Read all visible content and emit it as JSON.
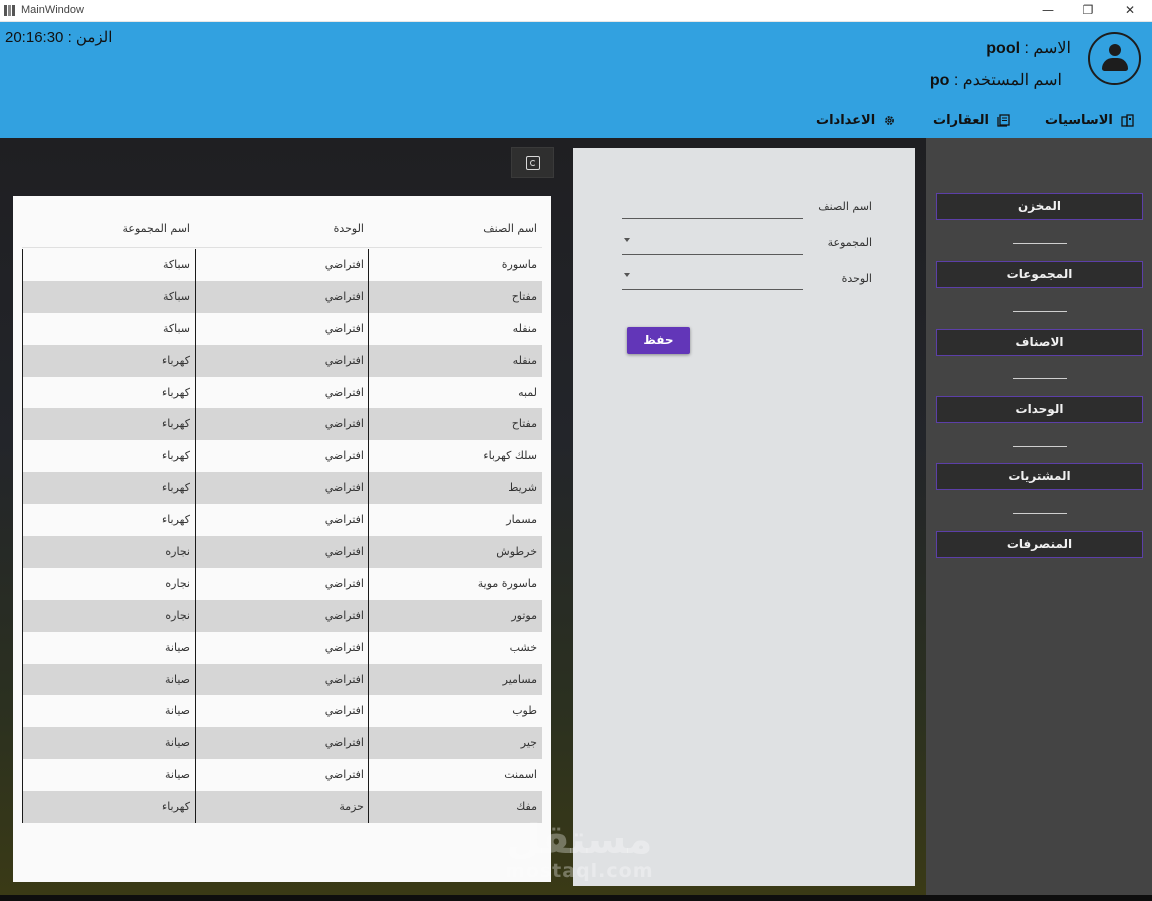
{
  "window": {
    "title": "MainWindow",
    "minimize": "—",
    "maximize": "❐",
    "close": "✕"
  },
  "header": {
    "name_label": "الاسم :",
    "name_value": "pool",
    "username_label": "اسم المستخدم :",
    "username_value": "po",
    "time_label": "الزمن :",
    "time_value": "20:16:30",
    "menu": [
      {
        "label": "الاساسيات",
        "icon": "building-icon"
      },
      {
        "label": "العقارات",
        "icon": "documents-icon"
      },
      {
        "label": "الاعدادات",
        "icon": "gear-icon"
      }
    ]
  },
  "sidebar": {
    "items": [
      "المخزن",
      "المجموعات",
      "الاصناف",
      "الوحدات",
      "المشتريات",
      "المنصرفات"
    ]
  },
  "form": {
    "item_name_label": "اسم الصنف",
    "item_name_value": "",
    "group_label": "المجموعة",
    "group_value": "",
    "unit_label": "الوحدة",
    "unit_value": "",
    "save_label": "حفظ"
  },
  "table": {
    "columns": [
      "اسم الصنف",
      "الوحدة",
      "اسم المجموعة"
    ],
    "rows": [
      [
        "ماسورة",
        "افتراضي",
        "سباكة"
      ],
      [
        "مفتاح",
        "افتراضي",
        "سباكة"
      ],
      [
        "منفله",
        "افتراضي",
        "سباكة"
      ],
      [
        "منفله",
        "افتراضي",
        "كهرباء"
      ],
      [
        "لمبه",
        "افتراضي",
        "كهرباء"
      ],
      [
        "مفتاح",
        "افتراضي",
        "كهرباء"
      ],
      [
        "سلك كهرباء",
        "افتراضي",
        "كهرباء"
      ],
      [
        "شريط",
        "افتراضي",
        "كهرباء"
      ],
      [
        "مسمار",
        "افتراضي",
        "كهرباء"
      ],
      [
        "خرطوش",
        "افتراضي",
        "نجاره"
      ],
      [
        "ماسورة موية",
        "افتراضي",
        "نجاره"
      ],
      [
        "موتور",
        "افتراضي",
        "نجاره"
      ],
      [
        "خشب",
        "افتراضي",
        "صيانة"
      ],
      [
        "مسامير",
        "افتراضي",
        "صيانة"
      ],
      [
        "طوب",
        "افتراضي",
        "صيانة"
      ],
      [
        "جير",
        "افتراضي",
        "صيانة"
      ],
      [
        "اسمنت",
        "افتراضي",
        "صيانة"
      ],
      [
        "مفك",
        "حزمة",
        "كهرباء"
      ]
    ]
  },
  "watermark": {
    "arabic": "مستقل",
    "latin": "mostaql.com"
  }
}
